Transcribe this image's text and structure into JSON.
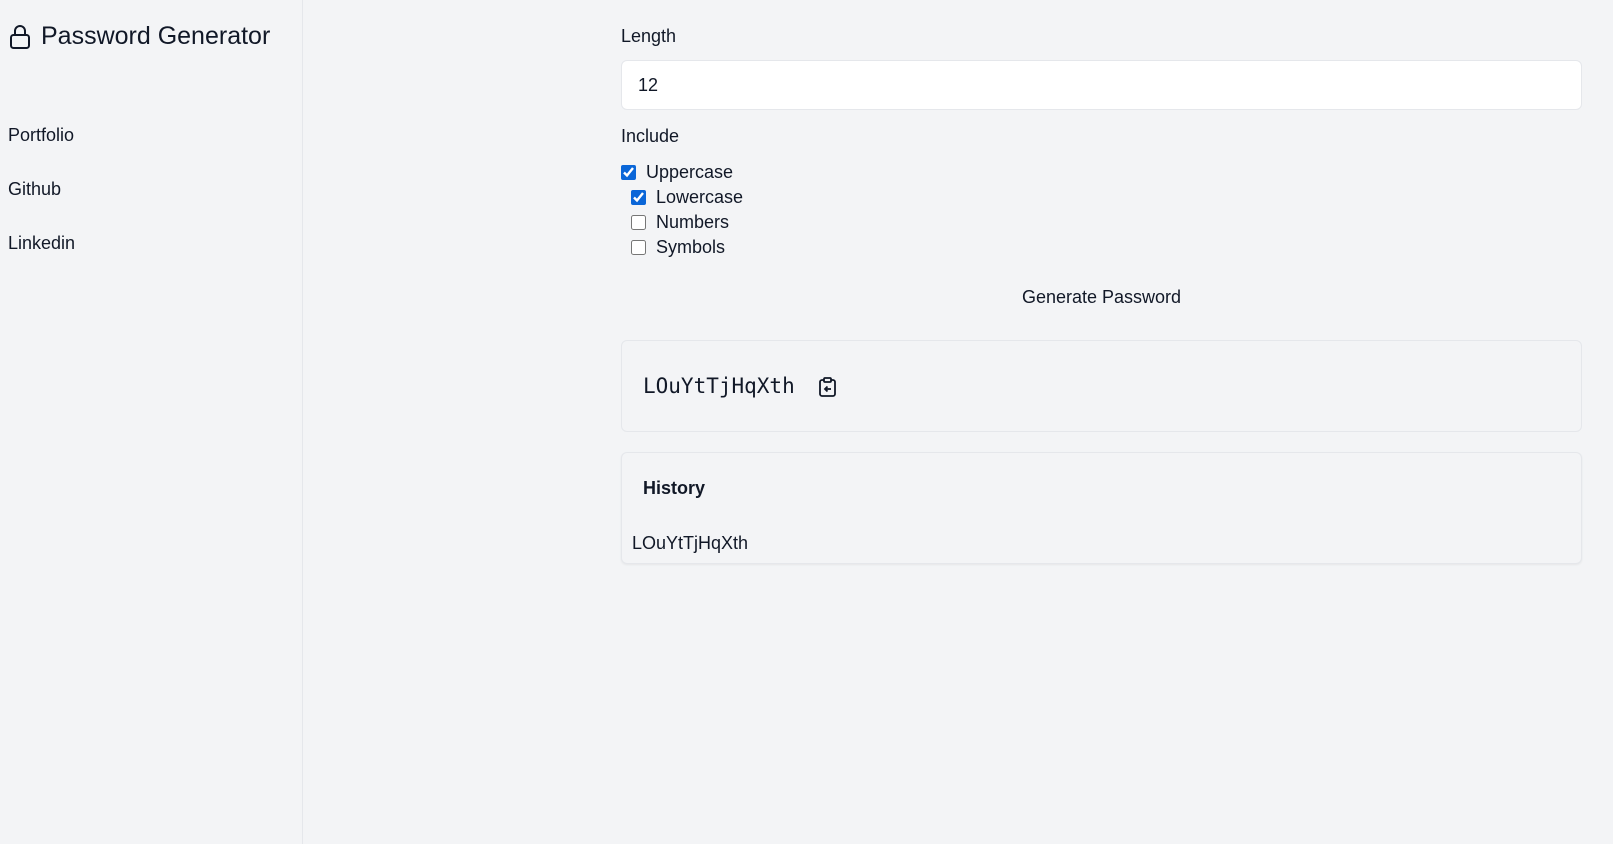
{
  "app": {
    "title": "Password Generator",
    "icon": "lock-icon"
  },
  "sidebar": {
    "items": [
      {
        "label": "Portfolio"
      },
      {
        "label": "Github"
      },
      {
        "label": "Linkedin"
      }
    ]
  },
  "form": {
    "length_label": "Length",
    "length_value": "12",
    "include_label": "Include",
    "options": [
      {
        "label": "Uppercase",
        "checked": true
      },
      {
        "label": "Lowercase",
        "checked": true
      },
      {
        "label": "Numbers",
        "checked": false
      },
      {
        "label": "Symbols",
        "checked": false
      }
    ],
    "generate_label": "Generate Password"
  },
  "result": {
    "password": "LOuYtTjHqXth",
    "copy_icon": "clipboard-copy-icon"
  },
  "history": {
    "title": "History",
    "items": [
      "LOuYtTjHqXth"
    ]
  },
  "colors": {
    "background": "#f3f4f6",
    "checkbox_accent": "#0a66d8",
    "border": "#e5e7eb"
  }
}
